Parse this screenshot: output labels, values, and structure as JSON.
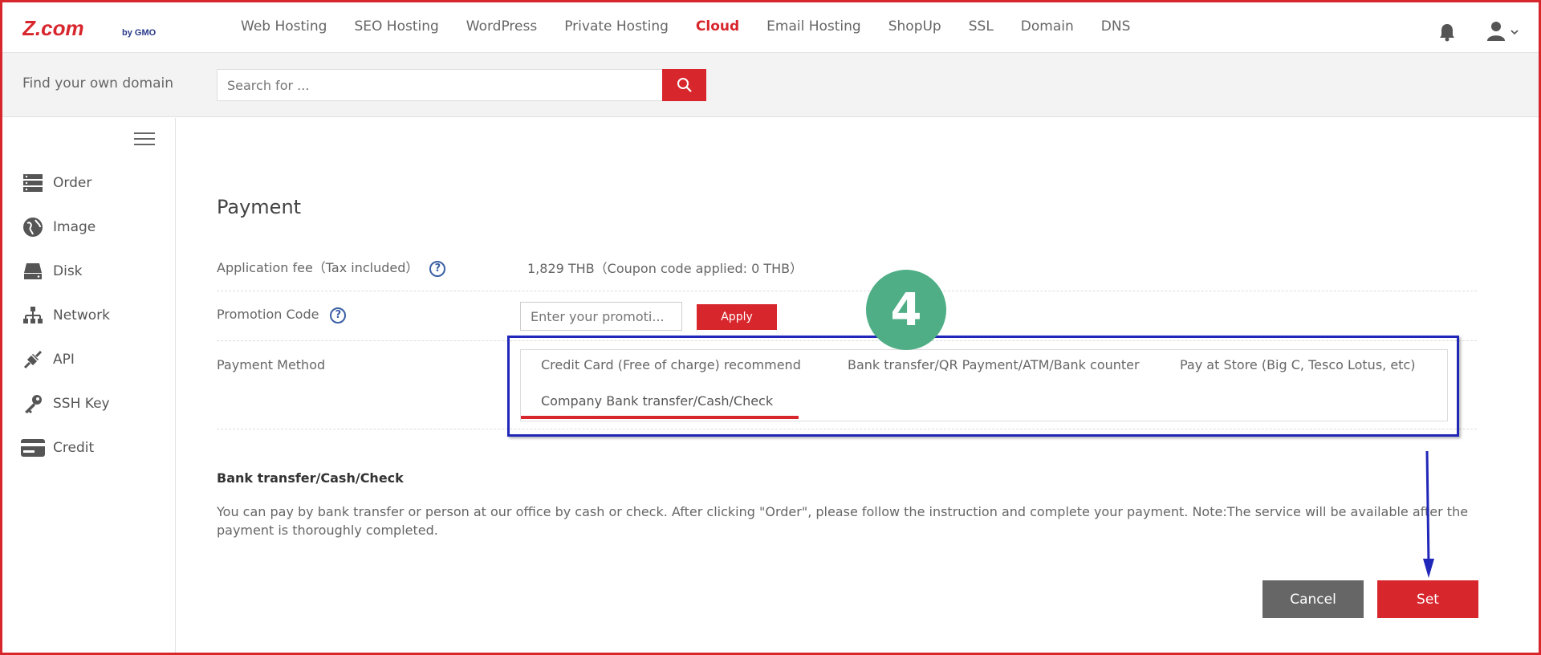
{
  "brand": {
    "name": "Z.com",
    "suffix": "by GMO"
  },
  "nav": {
    "items": [
      {
        "label": "Web Hosting"
      },
      {
        "label": "SEO Hosting"
      },
      {
        "label": "WordPress"
      },
      {
        "label": "Private Hosting"
      },
      {
        "label": "Cloud"
      },
      {
        "label": "Email Hosting"
      },
      {
        "label": "ShopUp"
      },
      {
        "label": "SSL"
      },
      {
        "label": "Domain"
      },
      {
        "label": "DNS"
      }
    ],
    "active": "Cloud"
  },
  "domain_search": {
    "label": "Find your own domain",
    "placeholder": "Search for ..."
  },
  "sidebar": {
    "items": [
      {
        "label": "Order",
        "icon": "server-icon"
      },
      {
        "label": "Image",
        "icon": "globe-icon"
      },
      {
        "label": "Disk",
        "icon": "disk-icon"
      },
      {
        "label": "Network",
        "icon": "network-icon"
      },
      {
        "label": "API",
        "icon": "api-icon"
      },
      {
        "label": "SSH Key",
        "icon": "key-icon"
      },
      {
        "label": "Credit",
        "icon": "credit-card-icon"
      }
    ]
  },
  "payment": {
    "title": "Payment",
    "fee_label": "Application fee（Tax included）",
    "fee_value": "1,829 THB（Coupon code applied:   0 THB）",
    "promo_label": "Promotion Code",
    "promo_placeholder": "Enter your promoti...",
    "apply_label": "Apply",
    "method_label": "Payment Method",
    "methods": [
      {
        "label": "Credit Card (Free of charge) recommend"
      },
      {
        "label": "Bank transfer/QR Payment/ATM/Bank counter"
      },
      {
        "label": "Pay at Store (Big C, Tesco Lotus, etc)"
      },
      {
        "label": "Company Bank transfer/Cash/Check"
      }
    ],
    "selected_method": "Company Bank transfer/Cash/Check",
    "detail_title": "Bank transfer/Cash/Check",
    "detail_text": "You can pay by bank transfer or person at our office by cash or check. After clicking \"Order\", please follow the instruction and complete your payment. Note:The service will be available after the payment is thoroughly completed."
  },
  "actions": {
    "cancel": "Cancel",
    "set": "Set"
  },
  "annotation": {
    "step": "4"
  },
  "colors": {
    "brand_red": "#d8262d",
    "highlight_blue": "#2127b8",
    "step_green": "#4fae86",
    "cancel_gray": "#666666"
  }
}
